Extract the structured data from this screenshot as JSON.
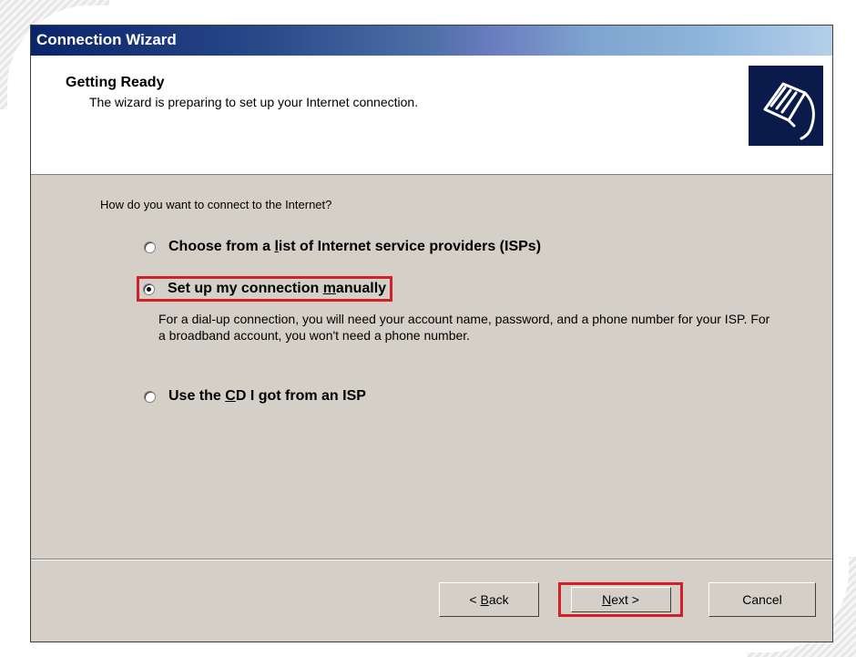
{
  "window": {
    "title": "Connection Wizard"
  },
  "header": {
    "title": "Getting Ready",
    "subtitle": "The wizard is preparing to set up your Internet connection.",
    "icon": "network-cable-icon"
  },
  "main": {
    "question": "How do you want to connect to the Internet?",
    "options": [
      {
        "label_pre": "Choose from a ",
        "label_accel": "l",
        "label_post": "ist of Internet service providers (ISPs)",
        "selected": false
      },
      {
        "label_pre": "Set up my connection ",
        "label_accel": "m",
        "label_post": "anually",
        "selected": true
      },
      {
        "label_pre": "Use the ",
        "label_accel": "C",
        "label_post": "D I got from an ISP",
        "selected": false
      }
    ],
    "description": "For a dial-up connection, you will need your account name, password, and a phone number for your ISP. For a broadband account, you won't need a phone number."
  },
  "buttons": {
    "back": {
      "pre": "< ",
      "accel": "B",
      "post": "ack"
    },
    "next": {
      "pre": "",
      "accel": "N",
      "post": "ext >"
    },
    "cancel": {
      "label": "Cancel"
    }
  },
  "colors": {
    "highlight": "#d0202a",
    "dialog_bg": "#d4d0c8",
    "titlebar_start": "#0a246a"
  }
}
